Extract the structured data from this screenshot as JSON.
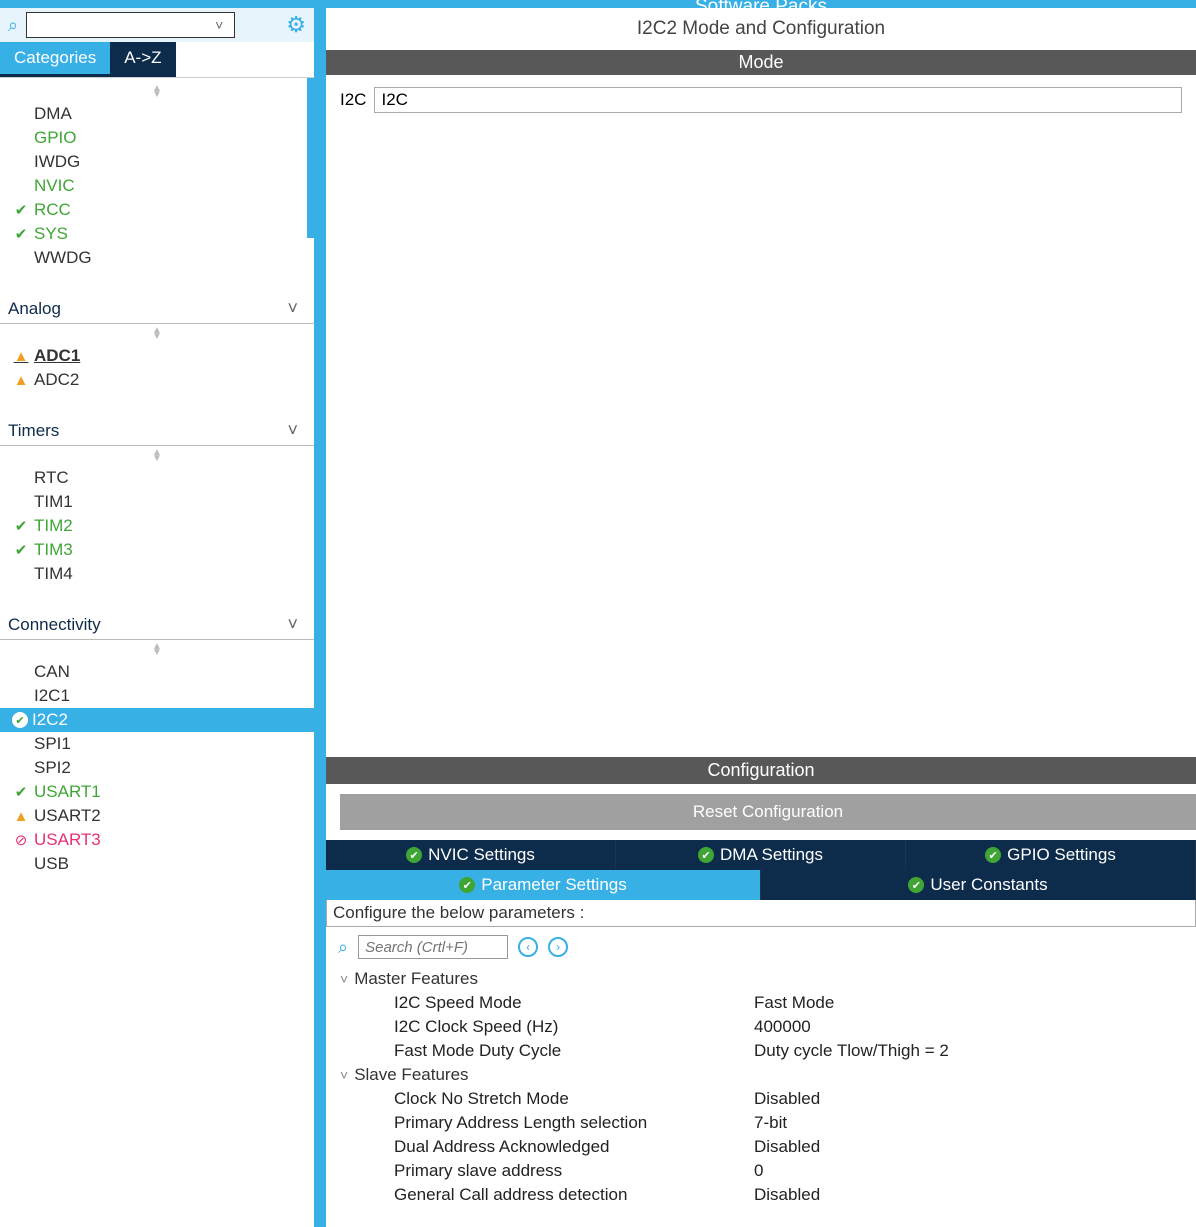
{
  "header": {
    "software_packs": "Software Packs"
  },
  "left": {
    "tabs": {
      "categories": "Categories",
      "az": "A->Z"
    },
    "system_core_items": [
      {
        "label": "DMA",
        "status": "",
        "cls": ""
      },
      {
        "label": "GPIO",
        "status": "",
        "cls": "green"
      },
      {
        "label": "IWDG",
        "status": "",
        "cls": ""
      },
      {
        "label": "NVIC",
        "status": "",
        "cls": "green"
      },
      {
        "label": "RCC",
        "status": "check",
        "cls": "green"
      },
      {
        "label": "SYS",
        "status": "check",
        "cls": "green"
      },
      {
        "label": "WWDG",
        "status": "",
        "cls": ""
      }
    ],
    "categories": {
      "analog": "Analog",
      "analog_items": [
        {
          "label": "ADC1",
          "status": "warn",
          "cls": "bold-underline"
        },
        {
          "label": "ADC2",
          "status": "warn",
          "cls": ""
        }
      ],
      "timers": "Timers",
      "timers_items": [
        {
          "label": "RTC",
          "status": "",
          "cls": ""
        },
        {
          "label": "TIM1",
          "status": "",
          "cls": ""
        },
        {
          "label": "TIM2",
          "status": "check",
          "cls": "green"
        },
        {
          "label": "TIM3",
          "status": "check",
          "cls": "green"
        },
        {
          "label": "TIM4",
          "status": "",
          "cls": ""
        }
      ],
      "connectivity": "Connectivity",
      "connectivity_items": [
        {
          "label": "CAN",
          "status": "",
          "cls": ""
        },
        {
          "label": "I2C1",
          "status": "",
          "cls": ""
        },
        {
          "label": "I2C2",
          "status": "check-circle",
          "cls": "selected"
        },
        {
          "label": "SPI1",
          "status": "",
          "cls": ""
        },
        {
          "label": "SPI2",
          "status": "",
          "cls": ""
        },
        {
          "label": "USART1",
          "status": "check",
          "cls": "green"
        },
        {
          "label": "USART2",
          "status": "warn",
          "cls": ""
        },
        {
          "label": "USART3",
          "status": "block",
          "cls": "",
          "color": "#e63078"
        },
        {
          "label": "USB",
          "status": "",
          "cls": ""
        }
      ]
    }
  },
  "right": {
    "title": "I2C2 Mode and Configuration",
    "mode_header": "Mode",
    "mode_label": "I2C",
    "mode_value": "I2C",
    "config_header": "Configuration",
    "reset_btn": "Reset Configuration",
    "tabs_row1": [
      "NVIC Settings",
      "DMA Settings",
      "GPIO Settings"
    ],
    "tabs_row2": [
      "Parameter Settings",
      "User Constants"
    ],
    "conf_desc": "Configure the below parameters :",
    "search_placeholder": "Search (Crtl+F)",
    "groups": {
      "master": "Master Features",
      "master_params": [
        {
          "label": "I2C Speed Mode",
          "value": "Fast Mode"
        },
        {
          "label": "I2C Clock Speed (Hz)",
          "value": "400000"
        },
        {
          "label": "Fast Mode Duty Cycle",
          "value": "Duty cycle Tlow/Thigh = 2"
        }
      ],
      "slave": "Slave Features",
      "slave_params": [
        {
          "label": "Clock No Stretch Mode",
          "value": "Disabled"
        },
        {
          "label": "Primary Address Length selection",
          "value": "7-bit"
        },
        {
          "label": "Dual Address Acknowledged",
          "value": "Disabled"
        },
        {
          "label": "Primary slave address",
          "value": "0"
        },
        {
          "label": "General Call address detection",
          "value": "Disabled"
        }
      ]
    }
  }
}
